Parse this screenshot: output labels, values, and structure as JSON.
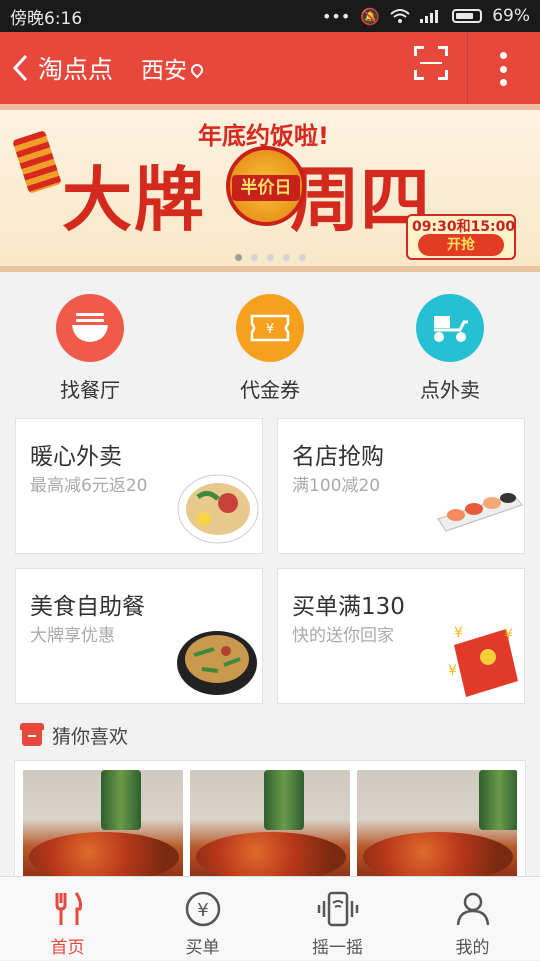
{
  "status_bar": {
    "time": "傍晚6:16",
    "battery": "69%"
  },
  "header": {
    "back_label": "<",
    "title": "淘点点",
    "city": "西安"
  },
  "banner": {
    "subtitle": "年底约饭啦!",
    "headline_left": "大牌",
    "headline_right": "周四",
    "badge": "半价日",
    "time": "09:30和15:00",
    "cta": "开抢",
    "page_count": 5,
    "active_page": 1
  },
  "categories": [
    {
      "label": "找餐厅",
      "icon": "bowl-icon",
      "color": "#ef5a4b"
    },
    {
      "label": "代金券",
      "icon": "voucher-icon",
      "color": "#f5a01e"
    },
    {
      "label": "点外卖",
      "icon": "scooter-icon",
      "color": "#26c0d3"
    }
  ],
  "promo_cards": [
    {
      "title": "暖心外卖",
      "subtitle": "最高减6元返20"
    },
    {
      "title": "名店抢购",
      "subtitle": "满100减20"
    },
    {
      "title": "美食自助餐",
      "subtitle": "大牌享优惠"
    },
    {
      "title": "买单满130",
      "subtitle": "快的送你回家"
    }
  ],
  "section": {
    "title": "猜你喜欢"
  },
  "tabbar": {
    "items": [
      {
        "label": "首页",
        "icon": "fork-knife-icon"
      },
      {
        "label": "买单",
        "icon": "yuan-circle-icon"
      },
      {
        "label": "摇一摇",
        "icon": "shake-phone-icon"
      },
      {
        "label": "我的",
        "icon": "user-icon"
      }
    ],
    "active_index": 0
  },
  "colors": {
    "brand": "#e8483c",
    "banner_red": "#d42a1e"
  }
}
